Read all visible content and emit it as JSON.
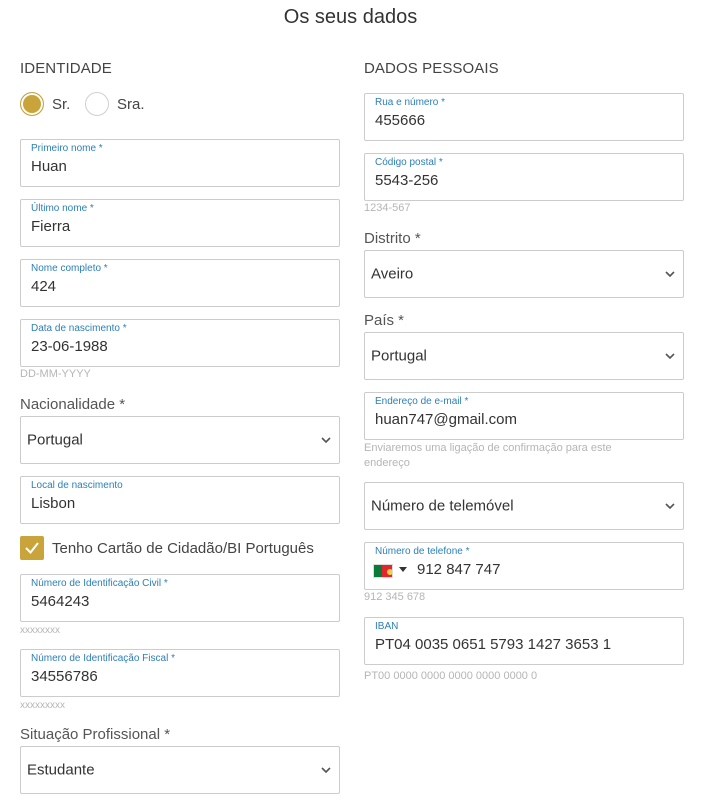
{
  "page": {
    "title": "Os seus dados"
  },
  "identity": {
    "heading": "IDENTIDADE",
    "salutation": {
      "option_mr": "Sr.",
      "option_mrs": "Sra.",
      "selected": "Sr."
    },
    "first_name": {
      "label": "Primeiro nome *",
      "value": "Huan"
    },
    "last_name": {
      "label": "Último nome *",
      "value": "Fierra"
    },
    "full_name": {
      "label": "Nome completo *",
      "value": "424"
    },
    "birth_date": {
      "label": "Data de nascimento *",
      "value": "23-06-1988",
      "hint": "DD-MM-YYYY"
    },
    "nationality": {
      "label": "Nacionalidade *",
      "value": "Portugal"
    },
    "birth_place": {
      "label": "Local de nascimento",
      "value": "Lisbon"
    },
    "citizen_card": {
      "label": "Tenho Cartão de Cidadão/BI Português",
      "checked": true
    },
    "civil_id": {
      "label": "Número de Identificação Civil *",
      "value": "5464243",
      "hint": "xxxxxxxx"
    },
    "tax_id": {
      "label": "Número de Identificação Fiscal *",
      "value": "34556786",
      "hint": "xxxxxxxxx"
    },
    "professional_status": {
      "label": "Situação Profissional *",
      "value": "Estudante"
    }
  },
  "personal": {
    "heading": "DADOS PESSOAIS",
    "street": {
      "label": "Rua e número *",
      "value": "455666"
    },
    "postal_code": {
      "label": "Código postal *",
      "value": "5543-256",
      "hint": "1234-567"
    },
    "district": {
      "label": "Distrito *",
      "value": "Aveiro"
    },
    "country": {
      "label": "País *",
      "value": "Portugal"
    },
    "email": {
      "label": "Endereço de e-mail *",
      "value": "huan747@gmail.com",
      "hint_line1": "Enviaremos uma ligação de confirmação para este",
      "hint_line2": "endereço"
    },
    "phone_type": {
      "value": "Número de telemóvel"
    },
    "phone": {
      "label": "Número de telefone *",
      "value": "912 847 747",
      "hint": "912 345 678",
      "flag_icon": "portugal-flag-icon"
    },
    "iban": {
      "label": "IBAN",
      "value": "PT04 0035 0651 5793 1427 3653 1",
      "hint": "PT00 0000 0000 0000 0000 0000 0"
    }
  },
  "colors": {
    "accent": "#c9a43a",
    "label_blue": "#2c7fb8",
    "border": "#cccccc",
    "hint": "#b5b5b5"
  }
}
